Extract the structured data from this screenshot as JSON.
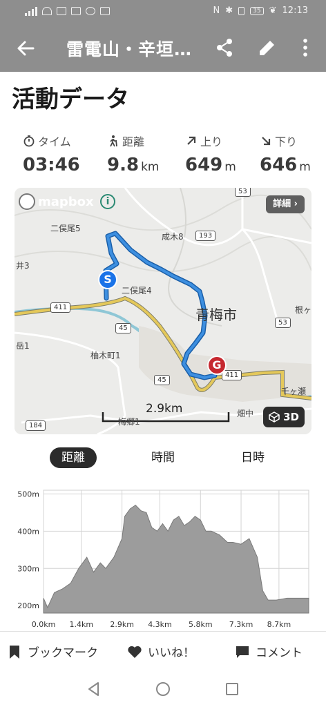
{
  "status_bar": {
    "time": "12:13",
    "battery": "35"
  },
  "app_bar": {
    "title": "雷電山・辛垣…"
  },
  "page_title": "活動データ",
  "stats": [
    {
      "label": "タイム",
      "value": "03:46",
      "unit": ""
    },
    {
      "label": "距離",
      "value": "9.8",
      "unit": "km"
    },
    {
      "label": "上り",
      "value": "649",
      "unit": "m"
    },
    {
      "label": "下り",
      "value": "646",
      "unit": "m"
    }
  ],
  "map": {
    "brand": "mapbox",
    "detail_button": "詳細 ›",
    "btn_3d": "3D",
    "scale": "2.9km",
    "start_marker": "S",
    "goal_marker": "G",
    "city": "青梅市",
    "labels": [
      "二俣尾5",
      "二俣尾4",
      "成木8",
      "柚木町1",
      "畑中",
      "千ヶ瀬",
      "梅郷1",
      "根ヶ",
      "井3",
      "岳1"
    ],
    "route_shields": [
      "53",
      "193",
      "411",
      "45",
      "53",
      "411",
      "45",
      "184"
    ]
  },
  "tabs": [
    "距離",
    "時間",
    "日時"
  ],
  "active_tab": "距離",
  "chart_data": {
    "type": "area",
    "title": "",
    "xlabel": "",
    "ylabel": "",
    "x_tick_labels": [
      "0.0km",
      "1.4km",
      "2.9km",
      "4.3km",
      "5.8km",
      "7.3km",
      "8.7km"
    ],
    "y_tick_labels": [
      "200m",
      "300m",
      "400m",
      "500m"
    ],
    "ylim": [
      180,
      510
    ],
    "xlim": [
      0,
      9.8
    ],
    "grid": true,
    "x": [
      0,
      0.15,
      0.4,
      0.7,
      1.0,
      1.3,
      1.6,
      1.85,
      2.1,
      2.3,
      2.6,
      2.9,
      3.0,
      3.2,
      3.4,
      3.6,
      3.8,
      4.0,
      4.2,
      4.4,
      4.6,
      4.8,
      5.0,
      5.2,
      5.4,
      5.6,
      5.8,
      6.0,
      6.2,
      6.5,
      6.8,
      7.0,
      7.3,
      7.6,
      7.9,
      8.1,
      8.3,
      8.6,
      9.0,
      9.4,
      9.8
    ],
    "y": [
      220,
      195,
      235,
      245,
      260,
      300,
      330,
      290,
      315,
      300,
      330,
      380,
      440,
      460,
      470,
      455,
      450,
      410,
      400,
      420,
      400,
      430,
      440,
      415,
      425,
      440,
      430,
      400,
      400,
      390,
      370,
      370,
      365,
      380,
      330,
      240,
      215,
      215,
      220,
      220,
      220
    ],
    "color": "#9c9c9c"
  },
  "bottom_actions": {
    "bookmark": "ブックマーク",
    "like": "いいね！",
    "comment": "コメント"
  }
}
